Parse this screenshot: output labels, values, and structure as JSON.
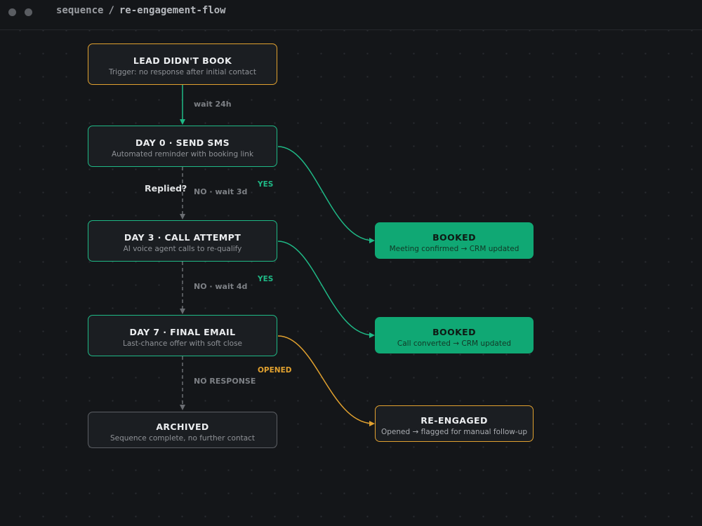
{
  "titlebar": {
    "crumb_root": "sequence",
    "crumb_separator": "/",
    "crumb_current": "re-engagement-flow"
  },
  "nodes": {
    "lead": {
      "title": "LEAD DIDN'T BOOK",
      "subtitle": "Trigger: no response after initial contact"
    },
    "day0": {
      "title": "DAY 0 · SEND SMS",
      "subtitle": "Automated reminder with booking link"
    },
    "day3": {
      "title": "DAY 3 · CALL ATTEMPT",
      "subtitle": "AI voice agent calls to re-qualify"
    },
    "day7": {
      "title": "DAY 7 · FINAL EMAIL",
      "subtitle": "Last-chance offer with soft close"
    },
    "archived": {
      "title": "ARCHIVED",
      "subtitle": "Sequence complete, no further contact"
    },
    "booked1": {
      "title": "BOOKED",
      "subtitle": "Meeting confirmed → CRM updated"
    },
    "booked2": {
      "title": "BOOKED",
      "subtitle": "Call converted → CRM updated"
    },
    "reengaged": {
      "title": "RE-ENGAGED",
      "subtitle": "Opened → flagged for manual follow-up"
    }
  },
  "edge_labels": {
    "wait24": "wait 24h",
    "replied": "Replied?",
    "no_wait3": "NO · wait 3d",
    "yes1": "YES",
    "no_wait4": "NO · wait 4d",
    "yes2": "YES",
    "opened": "OPENED",
    "no_response": "NO RESPONSE"
  },
  "colors": {
    "accent_green": "#1fb986",
    "accent_amber": "#e1a12f",
    "muted_line": "#6b6e73",
    "success_fill": "#10a874",
    "background": "#141619"
  }
}
